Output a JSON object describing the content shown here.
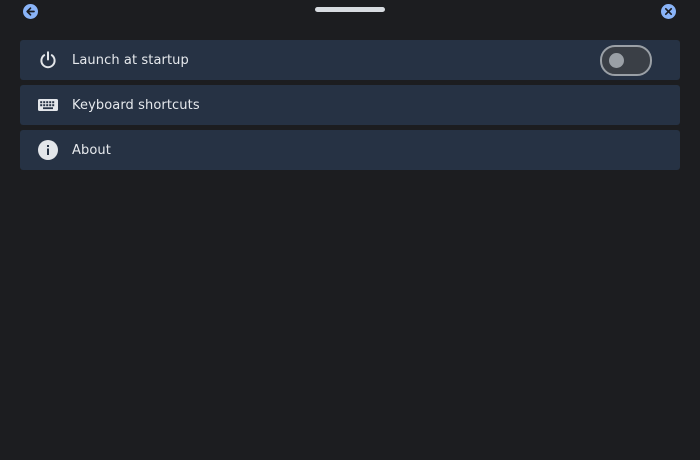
{
  "topbar": {
    "back_icon": "arrow-left-icon",
    "close_icon": "close-icon",
    "accent_color": "#8ab4f8"
  },
  "settings": {
    "items": [
      {
        "icon": "power-icon",
        "label": "Launch at startup",
        "control": "toggle",
        "toggle_on": false
      },
      {
        "icon": "keyboard-icon",
        "label": "Keyboard shortcuts"
      },
      {
        "icon": "info-icon",
        "label": "About"
      }
    ]
  },
  "colors": {
    "background": "#1c1d20",
    "row_background": "#263244"
  }
}
